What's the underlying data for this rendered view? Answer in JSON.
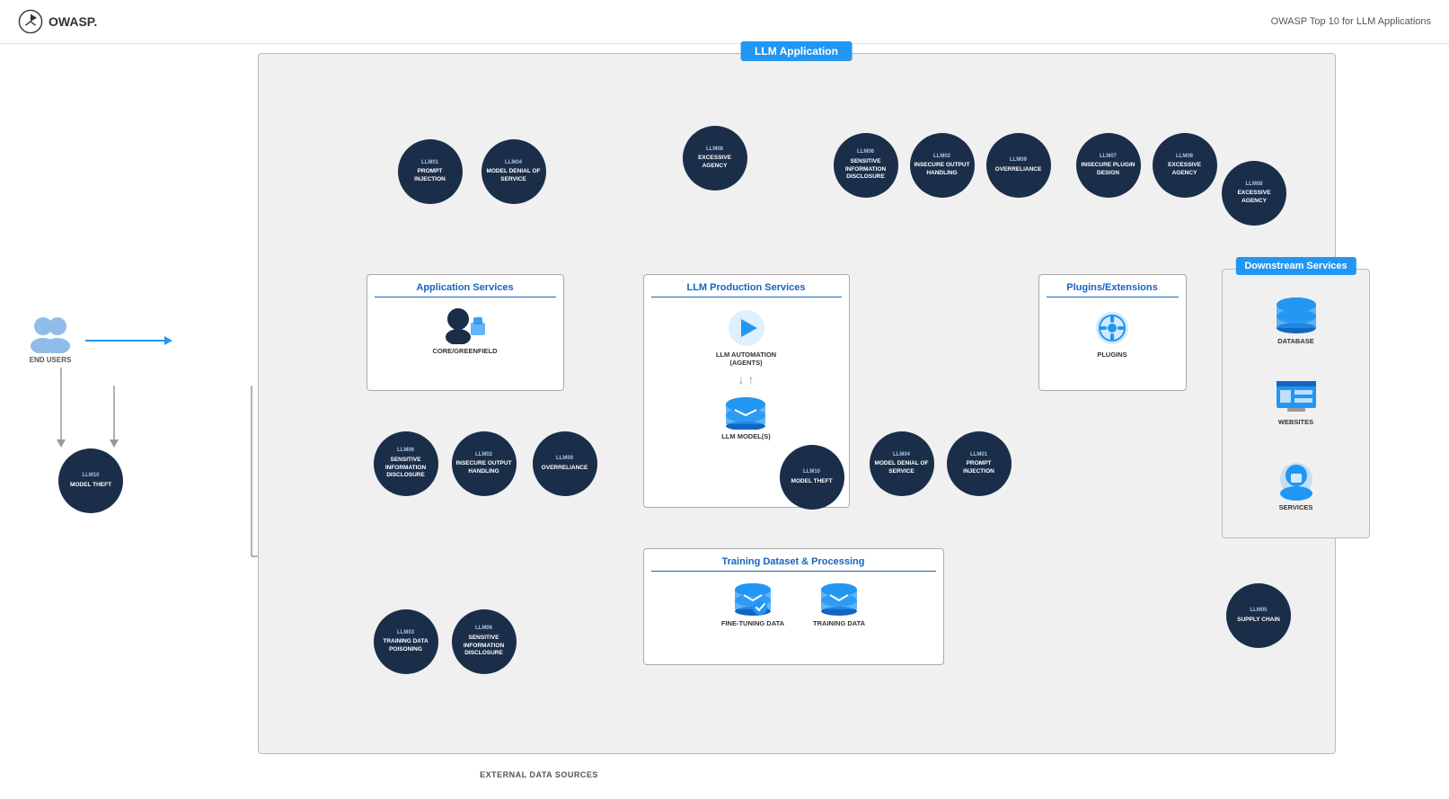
{
  "header": {
    "logo_text": "OWASP.",
    "title": "OWASP Top 10 for LLM Applications"
  },
  "diagram": {
    "main_box_label": "LLM Application",
    "sections": {
      "app_services": "Application Services",
      "llm_production": "LLM Production Services",
      "plugins": "Plugins/Extensions",
      "downstream": "Downstream Services",
      "training": "Training Dataset & Processing"
    },
    "nodes": {
      "end_users": "END USERS",
      "core_greenfield": "CORE/GREENFIELD",
      "llm_automation": "LLM AUTOMATION (AGENTS)",
      "llm_models": "LLM MODEL(S)",
      "plugins_node": "PLUGINS",
      "fine_tuning_data": "FINE-TUNING DATA",
      "training_data": "TRAINING DATA",
      "database": "DATABASE",
      "websites": "WEBSITES",
      "services": "SERVICES",
      "external_data": "EXTERNAL DATA SOURCES"
    },
    "llm_circles": [
      {
        "id": "LLM01",
        "label": "PROMPT INJECTION"
      },
      {
        "id": "LLM04",
        "label": "MODEL DENIAL OF SERVICE"
      },
      {
        "id": "LLM08",
        "label": "EXCESSIVE AGENCY"
      },
      {
        "id": "LLM06",
        "label": "SENSITIVE INFORMATION DISCLOSURE"
      },
      {
        "id": "LLM02",
        "label": "INSECURE OUTPUT HANDLING"
      },
      {
        "id": "LLM09",
        "label": "OVERRELIANCE"
      },
      {
        "id": "LLM07",
        "label": "INSECURE PLUGIN DESIGN"
      },
      {
        "id": "LLM08b",
        "label": "EXCESSIVE AGENCY"
      },
      {
        "id": "LLM08c",
        "label": "EXCESSIVE AGENCY"
      },
      {
        "id": "LLM10a",
        "label": "MODEL THEFT"
      },
      {
        "id": "LLM06b",
        "label": "SENSITIVE INFORMATION DISCLOSURE"
      },
      {
        "id": "LLM02b",
        "label": "INSECURE OUTPUT HANDLING"
      },
      {
        "id": "LLM09b",
        "label": "OVERRELIANCE"
      },
      {
        "id": "LLM10b",
        "label": "MODEL THEFT"
      },
      {
        "id": "LLM04b",
        "label": "MODEL DENIAL OF SERVICE"
      },
      {
        "id": "LLM01b",
        "label": "PROMPT INJECTION"
      },
      {
        "id": "LLM03",
        "label": "TRAINING DATA POISONING"
      },
      {
        "id": "LLM06c",
        "label": "SENSITIVE INFORMATION DISCLOSURE"
      },
      {
        "id": "LLM05",
        "label": "SUPPLY CHAIN"
      }
    ]
  }
}
